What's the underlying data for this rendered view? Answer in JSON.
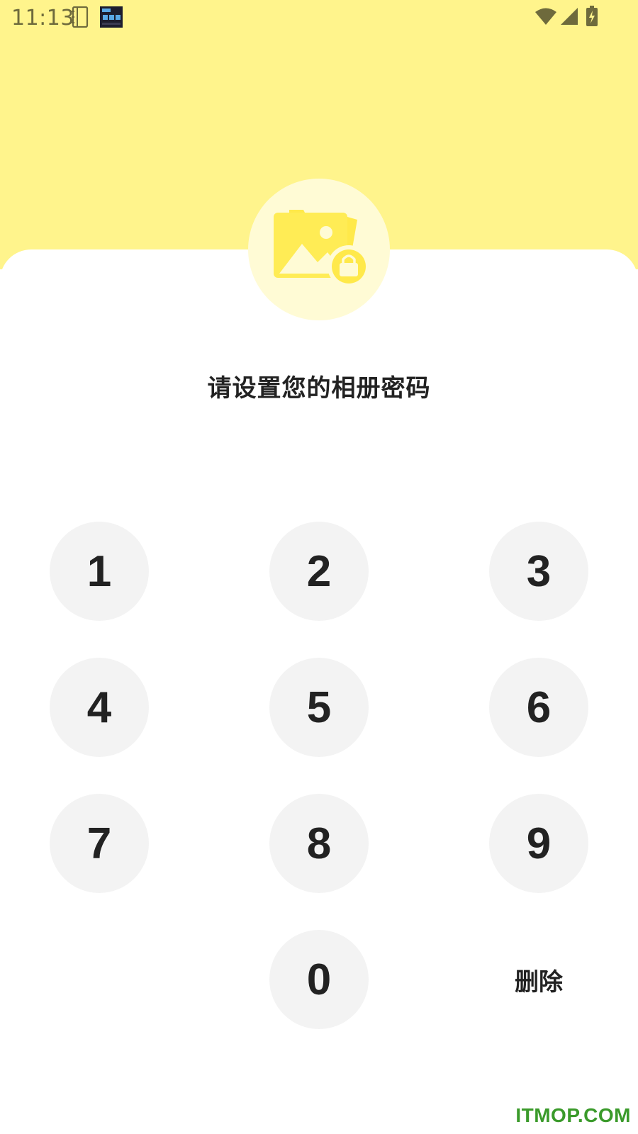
{
  "status_bar": {
    "time": "11:13",
    "icons": [
      "notebook-icon",
      "clock-widget-icon",
      "wifi-icon",
      "signal-icon",
      "battery-charging-icon"
    ]
  },
  "lock_screen": {
    "title": "请设置您的相册密码",
    "keypad": [
      "1",
      "2",
      "3",
      "4",
      "5",
      "6",
      "7",
      "8",
      "9",
      "0"
    ],
    "delete_label": "删除"
  },
  "watermark": "ITMOP.COM",
  "colors": {
    "header_bg": "#fff48c",
    "logo_bg": "#fffbd5",
    "accent": "#ffe94a",
    "key_bg": "#f3f3f3",
    "text": "#222222",
    "watermark": "#3a9a2a"
  }
}
